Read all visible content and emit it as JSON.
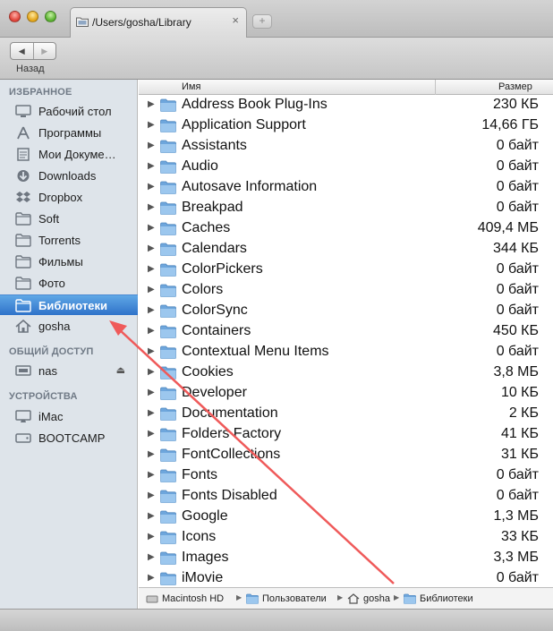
{
  "window": {
    "tab_title": "/Users/gosha/Library",
    "tab_close": "×",
    "new_tab": "+"
  },
  "toolbar": {
    "back_glyph": "◀",
    "forward_glyph": "▶",
    "back_label": "Назад"
  },
  "sidebar": {
    "favorites_header": "ИЗБРАННОЕ",
    "favorites": [
      {
        "label": "Рабочий стол",
        "icon": "desktop-icon"
      },
      {
        "label": "Программы",
        "icon": "applications-icon"
      },
      {
        "label": "Мои Докуме…",
        "icon": "documents-icon"
      },
      {
        "label": "Downloads",
        "icon": "downloads-icon"
      },
      {
        "label": "Dropbox",
        "icon": "dropbox-icon"
      },
      {
        "label": "Soft",
        "icon": "folder-icon"
      },
      {
        "label": "Torrents",
        "icon": "folder-icon"
      },
      {
        "label": "Фильмы",
        "icon": "folder-icon"
      },
      {
        "label": "Фото",
        "icon": "folder-icon"
      },
      {
        "label": "Библиотеки",
        "icon": "folder-icon",
        "selected": true
      },
      {
        "label": "gosha",
        "icon": "home-icon"
      }
    ],
    "shared_header": "ОБЩИЙ ДОСТУП",
    "shared": [
      {
        "label": "nas",
        "icon": "server-icon"
      }
    ],
    "eject_glyph": "⏏",
    "devices_header": "УСТРОЙСТВА",
    "devices": [
      {
        "label": "iMac",
        "icon": "imac-icon"
      },
      {
        "label": "BOOTCAMP",
        "icon": "disk-icon"
      }
    ]
  },
  "list": {
    "col_name": "Имя",
    "col_size": "Размер",
    "rows": [
      {
        "name": "Address Book Plug-Ins",
        "size": "230 КБ"
      },
      {
        "name": "Application Support",
        "size": "14,66 ГБ"
      },
      {
        "name": "Assistants",
        "size": "0 байт"
      },
      {
        "name": "Audio",
        "size": "0 байт"
      },
      {
        "name": "Autosave Information",
        "size": "0 байт"
      },
      {
        "name": "Breakpad",
        "size": "0 байт"
      },
      {
        "name": "Caches",
        "size": "409,4 МБ"
      },
      {
        "name": "Calendars",
        "size": "344 КБ"
      },
      {
        "name": "ColorPickers",
        "size": "0 байт"
      },
      {
        "name": "Colors",
        "size": "0 байт"
      },
      {
        "name": "ColorSync",
        "size": "0 байт"
      },
      {
        "name": "Containers",
        "size": "450 КБ"
      },
      {
        "name": "Contextual Menu Items",
        "size": "0 байт"
      },
      {
        "name": "Cookies",
        "size": "3,8 МБ"
      },
      {
        "name": "Developer",
        "size": "10 КБ"
      },
      {
        "name": "Documentation",
        "size": "2 КБ"
      },
      {
        "name": "Folders Factory",
        "size": "41 КБ"
      },
      {
        "name": "FontCollections",
        "size": "31 КБ"
      },
      {
        "name": "Fonts",
        "size": "0 байт"
      },
      {
        "name": "Fonts Disabled",
        "size": "0 байт"
      },
      {
        "name": "Google",
        "size": "1,3 МБ"
      },
      {
        "name": "Icons",
        "size": "33 КБ"
      },
      {
        "name": "Images",
        "size": "3,3 МБ"
      },
      {
        "name": "iMovie",
        "size": "0 байт"
      }
    ],
    "disclosure_glyph": "▶"
  },
  "pathbar": {
    "segments": [
      "Macintosh HD",
      "Пользователи",
      "gosha",
      "Библиотеки"
    ],
    "separator": "▶"
  },
  "colors": {
    "folder": "#7fb1e3",
    "selection": "#3a7fd4",
    "arrow": "#ef5a5a"
  }
}
